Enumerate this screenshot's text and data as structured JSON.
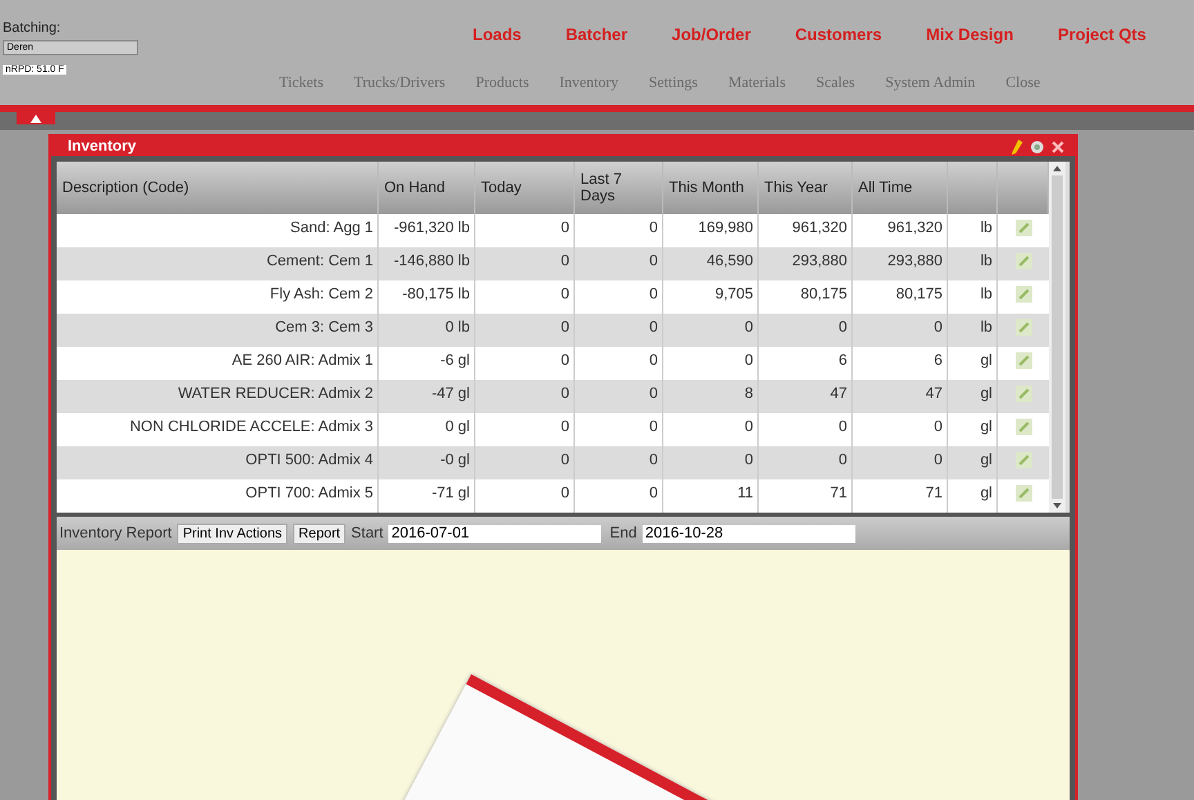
{
  "batching": {
    "label": "Batching:",
    "field_value": "Deren",
    "status": "nRPD: 51.0 F"
  },
  "main_nav": [
    "Loads",
    "Batcher",
    "Job/Order",
    "Customers",
    "Mix Design",
    "Project Qts"
  ],
  "sub_nav": [
    "Tickets",
    "Trucks/Drivers",
    "Products",
    "Inventory",
    "Settings",
    "Materials",
    "Scales",
    "System Admin",
    "Close"
  ],
  "panel": {
    "title": "Inventory",
    "table": {
      "columns": [
        "Description (Code)",
        "On Hand",
        "Today",
        "Last 7 Days",
        "This Month",
        "This Year",
        "All Time"
      ],
      "rows": [
        {
          "cells": [
            "Sand: Agg 1",
            "-961,320 lb",
            "0",
            "0",
            "169,980",
            "961,320",
            "961,320",
            "lb"
          ]
        },
        {
          "cells": [
            "Cement: Cem 1",
            "-146,880 lb",
            "0",
            "0",
            "46,590",
            "293,880",
            "293,880",
            "lb"
          ]
        },
        {
          "cells": [
            "Fly Ash: Cem 2",
            "-80,175 lb",
            "0",
            "0",
            "9,705",
            "80,175",
            "80,175",
            "lb"
          ]
        },
        {
          "cells": [
            "Cem 3: Cem 3",
            "0 lb",
            "0",
            "0",
            "0",
            "0",
            "0",
            "lb"
          ]
        },
        {
          "cells": [
            "AE 260 AIR: Admix 1",
            "-6 gl",
            "0",
            "0",
            "0",
            "6",
            "6",
            "gl"
          ]
        },
        {
          "cells": [
            "WATER REDUCER: Admix 2",
            "-47 gl",
            "0",
            "0",
            "8",
            "47",
            "47",
            "gl"
          ]
        },
        {
          "cells": [
            "NON CHLORIDE ACCELE: Admix 3",
            "0 gl",
            "0",
            "0",
            "0",
            "0",
            "0",
            "gl"
          ]
        },
        {
          "cells": [
            "OPTI 500: Admix 4",
            "-0 gl",
            "0",
            "0",
            "0",
            "0",
            "0",
            "gl"
          ]
        },
        {
          "cells": [
            "OPTI 700: Admix 5",
            "-71 gl",
            "0",
            "0",
            "11",
            "71",
            "71",
            "gl"
          ]
        }
      ]
    },
    "report": {
      "label": "Inventory Report",
      "buttons": [
        "Print Inv Actions",
        "Report"
      ],
      "start_label": "Start",
      "start_value": "2016-07-01",
      "end_label": "End",
      "end_value": "2016-10-28"
    }
  }
}
